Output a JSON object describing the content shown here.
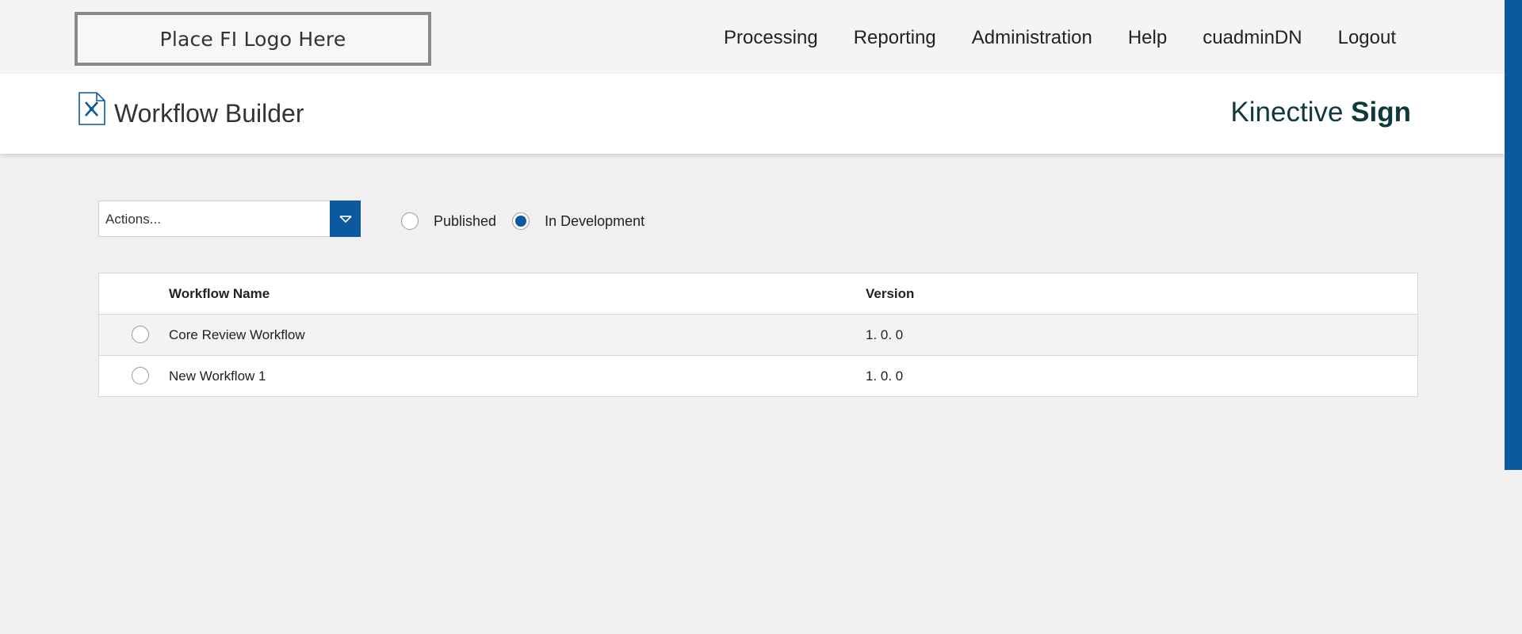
{
  "topbar": {
    "logo_text": "Place FI Logo Here",
    "nav": [
      {
        "label": "Processing"
      },
      {
        "label": "Reporting"
      },
      {
        "label": "Administration"
      },
      {
        "label": "Help"
      },
      {
        "label": "cuadminDN"
      },
      {
        "label": "Logout"
      }
    ]
  },
  "header": {
    "title": "Workflow Builder",
    "icon": "workflow-tools-document-icon",
    "brand_light": "Kinective ",
    "brand_bold": "Sign"
  },
  "controls": {
    "actions_value": "Actions...",
    "filter_options": [
      {
        "label": "Published",
        "selected": false
      },
      {
        "label": "In Development",
        "selected": true
      }
    ]
  },
  "table": {
    "columns": [
      "Workflow Name",
      "Version"
    ],
    "rows": [
      {
        "name": "Core Review Workflow",
        "version": "1. 0. 0",
        "selected": false
      },
      {
        "name": "New Workflow 1",
        "version": "1. 0. 0",
        "selected": false
      }
    ]
  },
  "colors": {
    "accent": "#0b5aa0",
    "brand": "#0e3a3d"
  }
}
